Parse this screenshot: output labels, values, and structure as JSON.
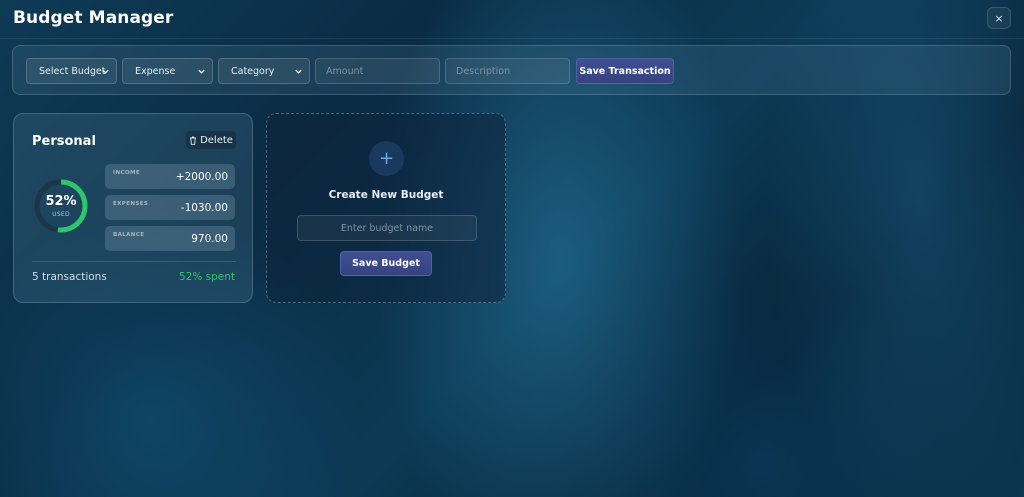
{
  "app": {
    "title": "Budget Manager",
    "close_label": "×"
  },
  "toolbar": {
    "select_budget": "Select Budget",
    "type_select": "Expense",
    "category_select": "Category",
    "amount_placeholder": "Amount",
    "description_placeholder": "Description",
    "save_transaction_label": "Save Transaction"
  },
  "budget": {
    "name": "Personal",
    "delete_label": "Delete",
    "used_percent": 52,
    "used_percent_text": "52%",
    "used_label": "USED",
    "income_label": "INCOME",
    "income_value": "+2000.00",
    "expenses_label": "EXPENSES",
    "expenses_value": "-1030.00",
    "balance_label": "BALANCE",
    "balance_value": "970.00",
    "transactions_text": "5 transactions",
    "spent_text": "52% spent"
  },
  "new_budget": {
    "plus_glyph": "+",
    "title": "Create New Budget",
    "name_placeholder": "Enter budget name",
    "save_label": "Save Budget"
  },
  "colors": {
    "accent_green": "#2ec66b",
    "button_indigo": "#3f4f92",
    "plus_blue": "#6fa8e6"
  },
  "icons": {
    "delete": "trash-icon",
    "dropdown": "chevron-down-icon",
    "close": "close-icon",
    "add": "plus-icon"
  }
}
